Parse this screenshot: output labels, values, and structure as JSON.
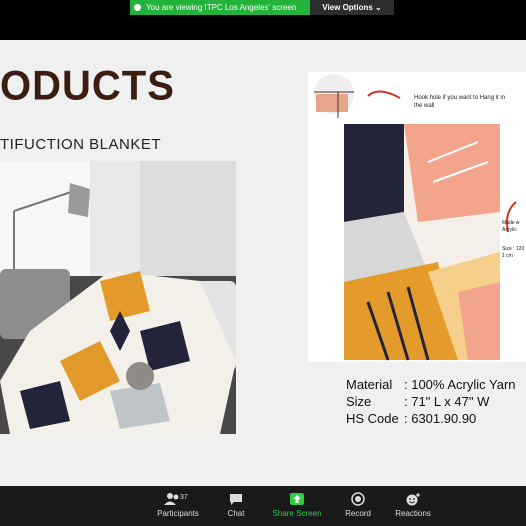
{
  "banner": {
    "viewing_text": "You are viewing ITPC Los Angeles' screen",
    "view_options_label": "View Options ⌄"
  },
  "slide": {
    "title": "ODUCTS",
    "subtitle": "TIFUCTION BLANKET",
    "design_notes": {
      "hook": "Hook hole if you want to Hang it in the wall",
      "made": "Made w Acrylic",
      "size": "Size : 120 x 1 cm"
    },
    "specs": [
      {
        "key": "Material",
        "value": ": 100% Acrylic Yarn"
      },
      {
        "key": "Size",
        "value": ": 71\" L x 47\"  W"
      },
      {
        "key": "HS Code",
        "value": ": 6301.90.90"
      }
    ]
  },
  "toolbar": {
    "participants_count": "37",
    "participants_label": "Participants",
    "chat_label": "Chat",
    "share_label": "Share Screen",
    "record_label": "Record",
    "reactions_label": "Reactions"
  },
  "colors": {
    "share_green": "#23b33a",
    "title_brown": "#3b1e12",
    "toolbar_bg": "#1a1a1a"
  }
}
